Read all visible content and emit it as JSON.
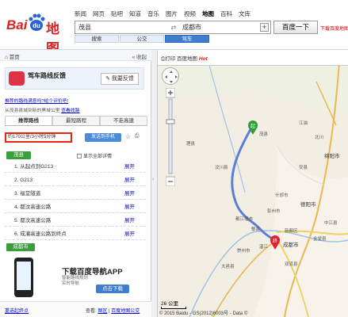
{
  "header": {
    "logo_text_left": "Bai",
    "logo_text_mid": "du",
    "logo_text_right": "地图",
    "nav": [
      "新闻",
      "网页",
      "贴吧",
      "知道",
      "音乐",
      "图片",
      "视频",
      "地图",
      "百科",
      "文库"
    ],
    "nav_active_index": 7,
    "search": {
      "from_value": "茂县",
      "to_value": "成都市",
      "button_label": "百度一下",
      "download_link": "下载百度地图"
    },
    "modes": [
      "搜索",
      "公交",
      "驾车"
    ],
    "mode_active_index": 2
  },
  "left_panel": {
    "home_label": "首页",
    "collapse_label": "收起",
    "banner": {
      "title": "驾车路线反馈",
      "button_label": "我要反馈"
    },
    "feedback_link": "推荐的路线满意吗?给个评价吧!",
    "links_text": "从茂县县城到新的黑城公里",
    "links_anchor": "查看线路",
    "tabs": [
      "推荐路线",
      "最短路程",
      "不走高速"
    ],
    "tab_active_index": 0,
    "summary": "约170公里/3小时5分钟",
    "send_button": "发送到手机",
    "start_badge": "茂县",
    "show_all": "显示全部详情",
    "steps": [
      {
        "label": "1. 从起点到G213",
        "expand": "展开"
      },
      {
        "label": "2. G213",
        "expand": "展开"
      },
      {
        "label": "3. 福堂隧道",
        "expand": "展开"
      },
      {
        "label": "4. 都汶高速公路",
        "expand": "展开"
      },
      {
        "label": "5. 都汶高速公路",
        "expand": "展开"
      },
      {
        "label": "6. 成灌高速公路到终点",
        "expand": "展开"
      }
    ],
    "end_badge": "成都市",
    "ad": {
      "title": "下载百度导航APP",
      "subtitle_1": "智能路线规划",
      "subtitle_2": "实时导航",
      "button_label": "点击下载"
    },
    "bottom": {
      "reset_link": "重选起终点",
      "view_label": "查看:",
      "view_link_1": "图区",
      "view_link_2": "百度地图公交"
    }
  },
  "map": {
    "print_label": "打印",
    "save_label": "百度地图",
    "hot_label": "Hot",
    "scale_label": "26 公里",
    "copyright": "© 2015 Baidu - GS(2012)6003号 - Data ©",
    "route_color": "#5a7fd6",
    "start_marker_label": "起",
    "end_marker_label": "终",
    "place_labels": [
      "茂县",
      "北川",
      "绵阳市",
      "江油",
      "安县",
      "德阳市",
      "什邡市",
      "彭州市",
      "都江堰市",
      "成都市",
      "汶川县",
      "理县",
      "中江县",
      "新都区",
      "郫县",
      "崇州市",
      "金堂县",
      "双流县",
      "温江",
      "大邑县"
    ]
  }
}
